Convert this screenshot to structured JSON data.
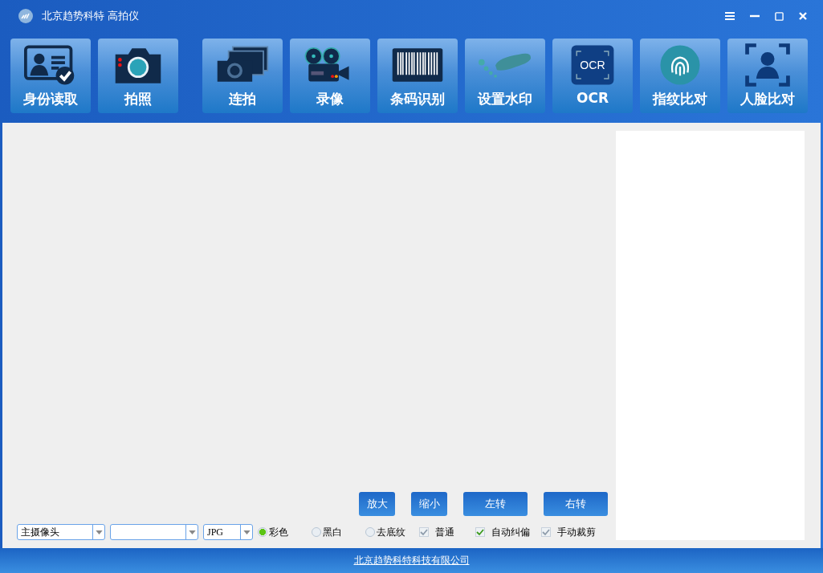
{
  "window": {
    "title": "北京趋势科特 高拍仪"
  },
  "toolbar": [
    {
      "kind": "idcard",
      "label": "身份读取"
    },
    {
      "kind": "camera",
      "label": "拍照"
    },
    {
      "kind": "burst",
      "label": "连拍"
    },
    {
      "kind": "video",
      "label": "录像"
    },
    {
      "kind": "barcode",
      "label": "条码识别"
    },
    {
      "kind": "watermark",
      "label": "设置水印"
    },
    {
      "kind": "ocr",
      "label": "OCR",
      "icon_text": "OCR"
    },
    {
      "kind": "fingerprint",
      "label": "指纹比对"
    },
    {
      "kind": "face",
      "label": "人脸比对"
    }
  ],
  "view_buttons": [
    {
      "label": "放大"
    },
    {
      "label": "缩小"
    },
    {
      "label": "左转"
    },
    {
      "label": "右转"
    }
  ],
  "selects": [
    {
      "kind": "dropdown",
      "value": "主摄像头"
    },
    {
      "kind": "dropdown"
    },
    {
      "kind": "dropdown",
      "value": "JPG"
    }
  ],
  "color_modes": [
    {
      "label": "彩色",
      "selected": true
    },
    {
      "label": "黑白",
      "selected": false
    },
    {
      "label": "去底纹",
      "selected": false
    }
  ],
  "options": [
    {
      "label": "普通",
      "checked": true,
      "disabled": true
    },
    {
      "label": "自动纠偏",
      "checked": true,
      "disabled": false
    },
    {
      "label": "手动裁剪",
      "checked": true,
      "disabled": true
    }
  ],
  "footer": {
    "link": "北京趋势科特科技有限公司"
  }
}
